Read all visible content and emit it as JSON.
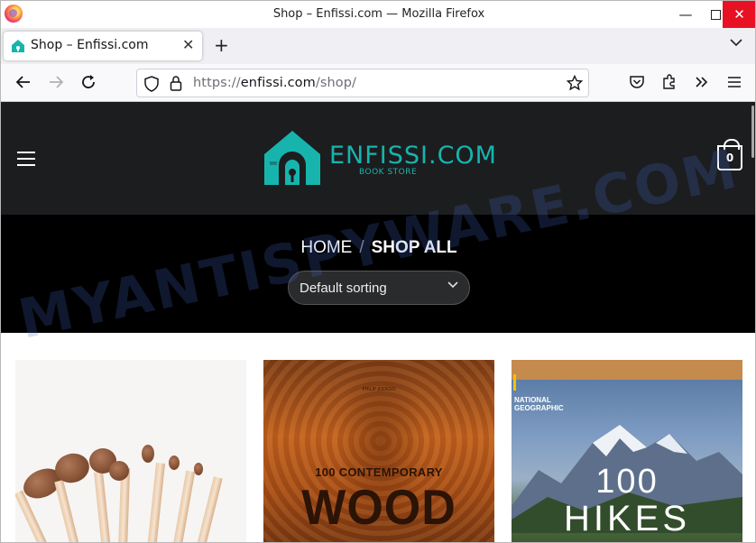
{
  "window": {
    "title": "Shop – Enfissi.com — Mozilla Firefox",
    "minimize_glyph": "—",
    "close_glyph": "✕"
  },
  "tabs": [
    {
      "label": "Shop – Enfissi.com",
      "close_glyph": "✕"
    }
  ],
  "tabstrip": {
    "new_tab_glyph": "+",
    "list_glyph": "⌄"
  },
  "urlbar": {
    "protocol": "https://",
    "host": "enfissi.com",
    "path": "/shop/"
  },
  "site": {
    "logo_name": "ENFISSI.COM",
    "logo_tagline": "BOOK STORE",
    "cart_count": "0",
    "accent_color": "#17b4ae"
  },
  "breadcrumb": {
    "home": "HOME",
    "separator": "/",
    "current": "SHOP ALL"
  },
  "sort": {
    "selected": "Default sorting",
    "chevron": "⌄"
  },
  "products": [
    {
      "image": "makeup-brushes"
    },
    {
      "image": "wood-book",
      "cover_top": "PHILIP JODIDIO",
      "cover_subtitle": "100 CONTEMPORARY",
      "cover_title": "WOOD"
    },
    {
      "image": "hikes-book",
      "cover_publisher_1": "NATIONAL",
      "cover_publisher_2": "GEOGRAPHIC",
      "cover_number": "100",
      "cover_title": "HIKES"
    }
  ],
  "watermark": "MYANTISPYWARE.COM"
}
